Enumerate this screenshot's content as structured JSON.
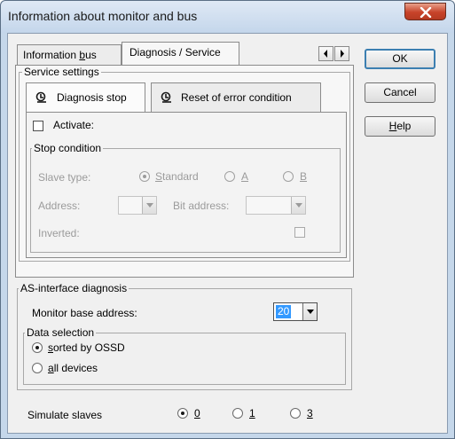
{
  "window": {
    "title": "Information about monitor and bus",
    "close_icon": "close-icon"
  },
  "tabs": [
    {
      "label": "Information bus",
      "underline_char": "b",
      "active": false
    },
    {
      "label": "Diagnosis / Service",
      "active": true
    }
  ],
  "tab_scroll": {
    "left_icon": "arrow-left-icon",
    "right_icon": "arrow-right-icon"
  },
  "buttons": {
    "ok": "OK",
    "cancel": "Cancel",
    "help": "Help"
  },
  "service_settings": {
    "title": "Service settings",
    "subtabs": [
      {
        "label": "Diagnosis stop",
        "icon": "tool-icon",
        "active": true
      },
      {
        "label": "Reset of error condition",
        "icon": "tool-icon",
        "active": false
      }
    ],
    "activate_label": "Activate:",
    "activate_checked": false,
    "stop_condition": {
      "title": "Stop condition",
      "slave_type_label": "Slave type:",
      "slave_types": [
        {
          "label": "Standard",
          "selected": true
        },
        {
          "label": "A",
          "selected": false
        },
        {
          "label": "B",
          "selected": false
        }
      ],
      "address_label": "Address:",
      "address_value": "",
      "bit_address_label": "Bit address:",
      "bit_address_value": "",
      "inverted_label": "Inverted:",
      "inverted_checked": false
    }
  },
  "asi_diagnosis": {
    "title": "AS-interface diagnosis",
    "monitor_base_address_label": "Monitor base address:",
    "monitor_base_address_value": "20",
    "data_selection": {
      "title": "Data selection",
      "options": [
        {
          "label": "sorted by OSSD",
          "selected": true
        },
        {
          "label": "all devices",
          "selected": false
        }
      ]
    }
  },
  "simulate": {
    "label": "Simulate slaves",
    "options": [
      {
        "label": "0",
        "selected": true
      },
      {
        "label": "1",
        "selected": false
      },
      {
        "label": "3",
        "selected": false
      }
    ]
  },
  "colors": {
    "title_bar": "#c5d7ea",
    "close_button": "#c7432a",
    "selection": "#3399ff"
  }
}
